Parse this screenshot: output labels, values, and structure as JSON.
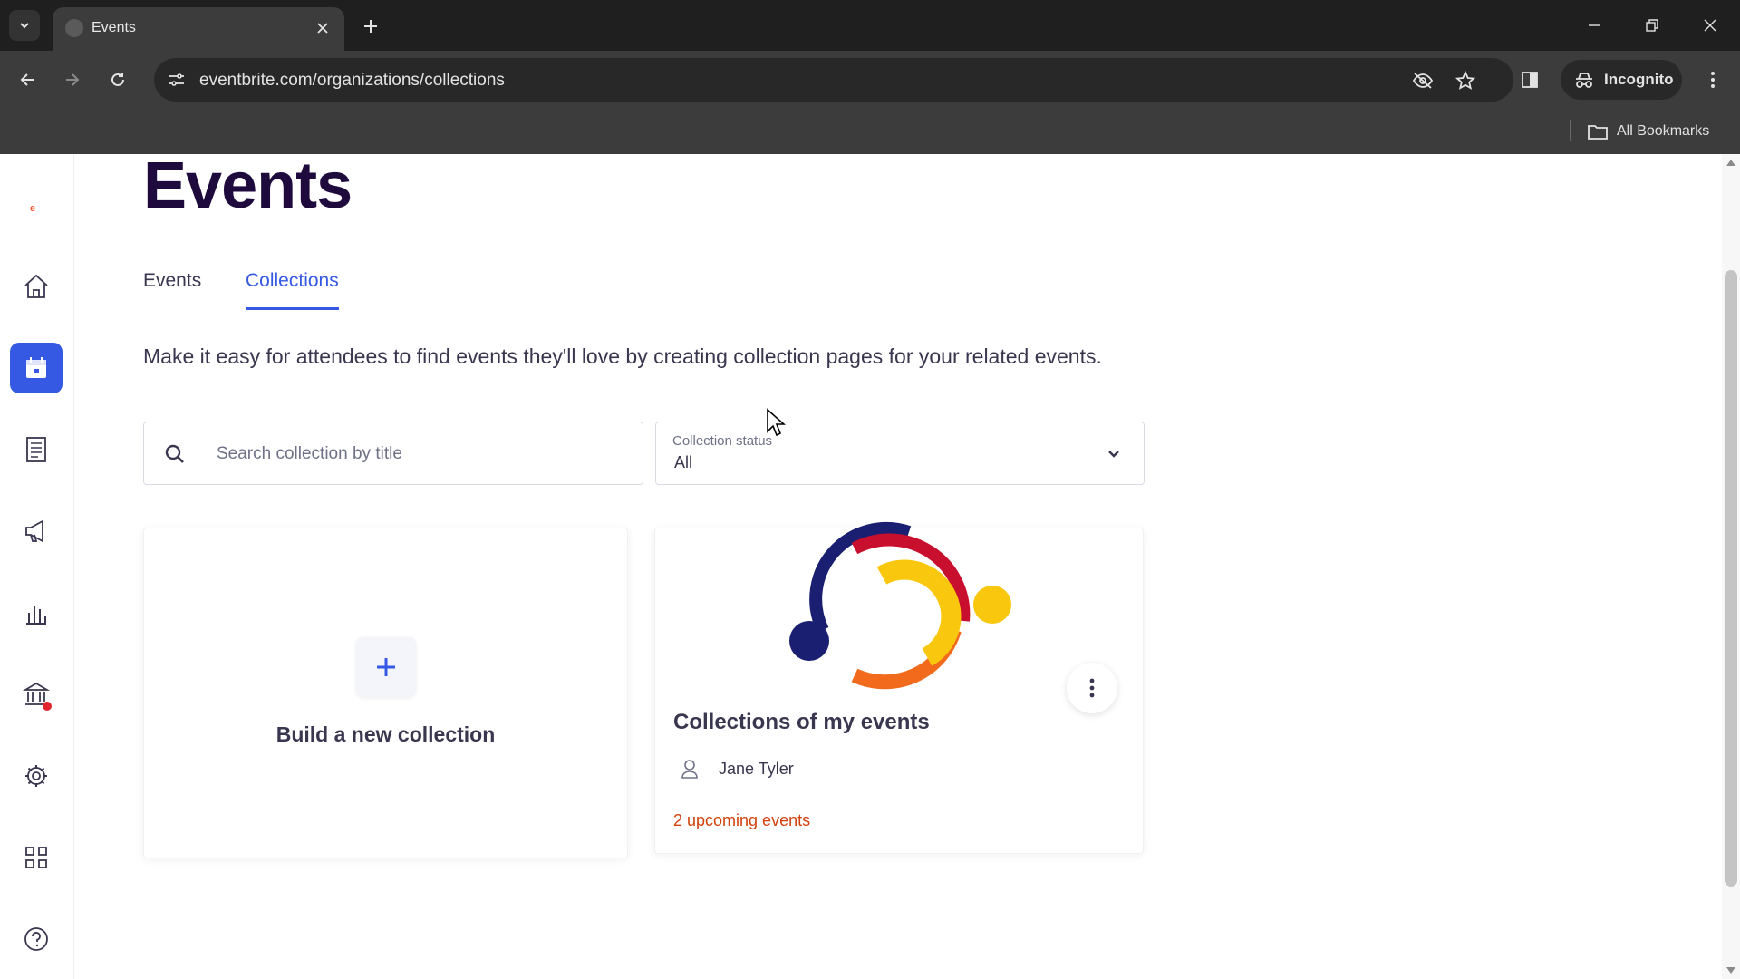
{
  "browser": {
    "tab_title": "Events",
    "url": "eventbrite.com/organizations/collections",
    "incognito_label": "Incognito",
    "bookmarks_label": "All Bookmarks"
  },
  "sidebar": {
    "brand": "e",
    "items": [
      {
        "name": "home",
        "icon": "home-icon"
      },
      {
        "name": "events",
        "icon": "calendar-icon",
        "active": true
      },
      {
        "name": "orders",
        "icon": "receipt-icon"
      },
      {
        "name": "marketing",
        "icon": "megaphone-icon"
      },
      {
        "name": "reporting",
        "icon": "bar-chart-icon"
      },
      {
        "name": "finance",
        "icon": "bank-icon",
        "notification": true
      },
      {
        "name": "settings",
        "icon": "gear-icon"
      },
      {
        "name": "apps",
        "icon": "grid-icon"
      },
      {
        "name": "help",
        "icon": "help-icon"
      }
    ]
  },
  "main": {
    "title": "Events",
    "tabs": [
      {
        "label": "Events",
        "active": false
      },
      {
        "label": "Collections",
        "active": true
      }
    ],
    "intro": "Make it easy for attendees to find events they'll love by creating collection pages for your related events.",
    "search": {
      "placeholder": "Search collection by title",
      "value": ""
    },
    "status_filter": {
      "label": "Collection status",
      "value": "All"
    },
    "new_card": {
      "label": "Build a new collection"
    },
    "collections": [
      {
        "title": "Collections of my events",
        "owner": "Jane Tyler",
        "upcoming": "2 upcoming events"
      }
    ]
  },
  "colors": {
    "accent": "#3659e3",
    "title": "#1e0a3c",
    "upcoming": "#d1410c",
    "logo_navy": "#1a1f71",
    "logo_red": "#c8102e",
    "logo_orange": "#f26b1d",
    "logo_yellow": "#f9c80e"
  }
}
